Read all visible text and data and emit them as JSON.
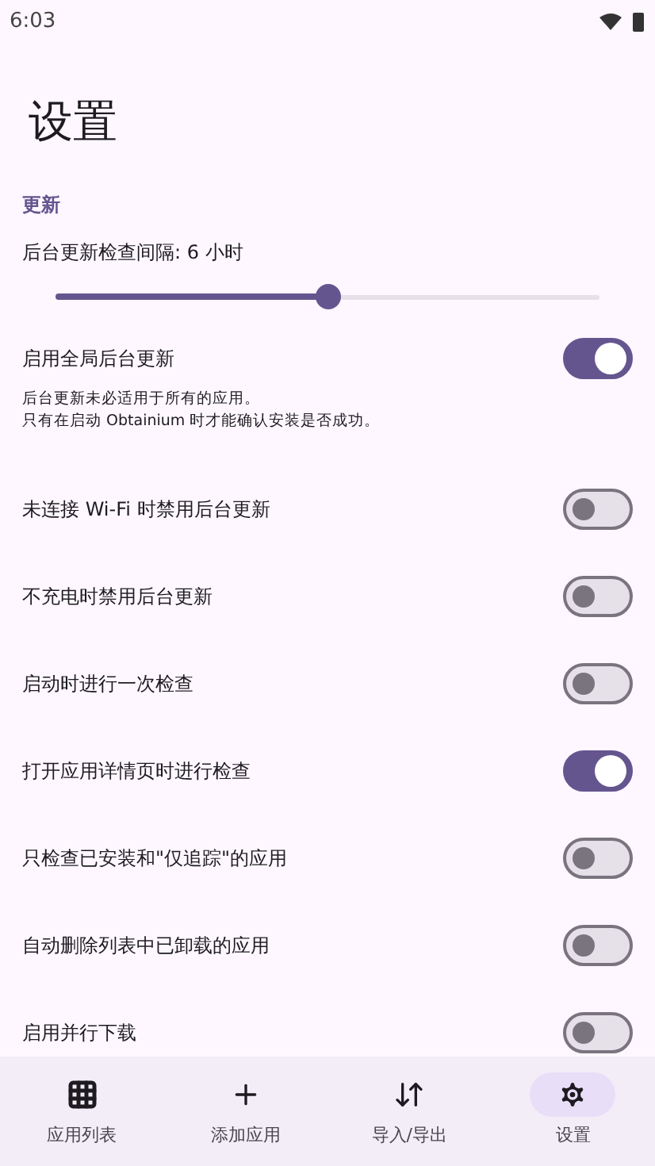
{
  "status_bar": {
    "time": "6:03"
  },
  "title": "设置",
  "section": "更新",
  "interval": {
    "label": "后台更新检查间隔: 6 小时",
    "level": 0.5
  },
  "settings": [
    {
      "label": "启用全局后台更新",
      "on": true,
      "note": [
        "后台更新未必适用于所有的应用。",
        "只有在启动 Obtainium 时才能确认安装是否成功。"
      ]
    },
    {
      "label": "未连接 Wi-Fi 时禁用后台更新",
      "on": false
    },
    {
      "label": "不充电时禁用后台更新",
      "on": false
    },
    {
      "label": "启动时进行一次检查",
      "on": false
    },
    {
      "label": "打开应用详情页时进行检查",
      "on": true
    },
    {
      "label": "只检查已安装和\"仅追踪\"的应用",
      "on": false
    },
    {
      "label": "自动删除列表中已卸载的应用",
      "on": false
    },
    {
      "label": "启用并行下载",
      "on": false
    }
  ],
  "nav": [
    {
      "label": "应用列表",
      "kind": "grid",
      "selected": false
    },
    {
      "label": "添加应用",
      "kind": "plus",
      "selected": false
    },
    {
      "label": "导入/导出",
      "kind": "arrows",
      "selected": false
    },
    {
      "label": "设置",
      "kind": "gear",
      "selected": true
    }
  ]
}
